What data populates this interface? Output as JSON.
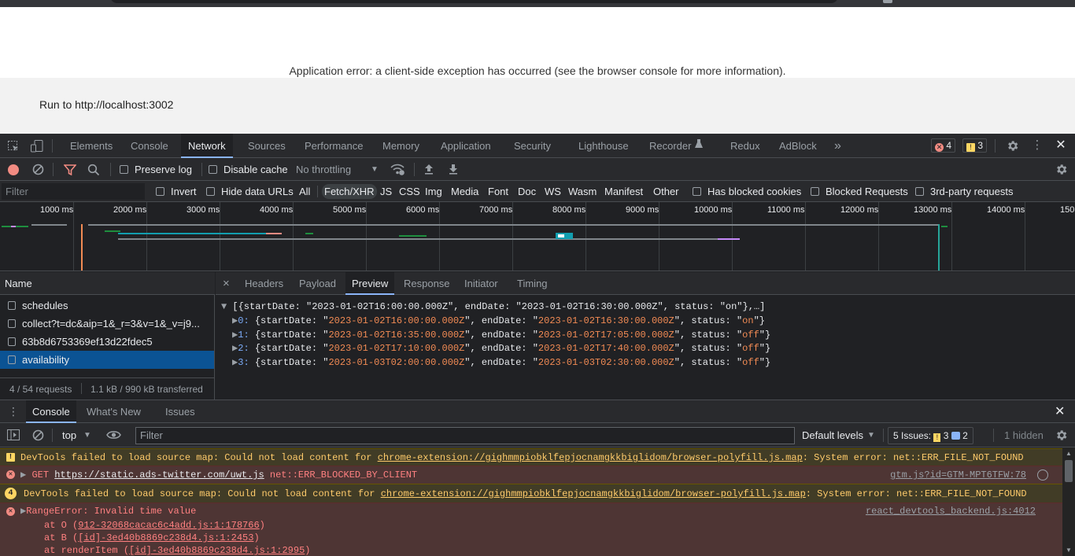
{
  "page": {
    "error_text": "Application error: a client-side exception has occurred (see the browser console for more information).",
    "run_text": "Run to http://localhost:3002"
  },
  "devtools": {
    "tabs": [
      "Elements",
      "Console",
      "Network",
      "Sources",
      "Performance",
      "Memory",
      "Application",
      "Security",
      "Lighthouse",
      "Recorder",
      "Redux",
      "AdBlock"
    ],
    "active_tab": "Network",
    "more_tabs": "»",
    "error_count": "4",
    "warning_count": "3"
  },
  "network_toolbar": {
    "preserve_log": "Preserve log",
    "disable_cache": "Disable cache",
    "throttling": "No throttling"
  },
  "filter_bar": {
    "placeholder": "Filter",
    "invert": "Invert",
    "hide_data_urls": "Hide data URLs",
    "types": [
      "All",
      "Fetch/XHR",
      "JS",
      "CSS",
      "Img",
      "Media",
      "Font",
      "Doc",
      "WS",
      "Wasm",
      "Manifest",
      "Other"
    ],
    "selected_type": "Fetch/XHR",
    "has_blocked_cookies": "Has blocked cookies",
    "blocked_requests": "Blocked Requests",
    "third_party": "3rd-party requests"
  },
  "timeline": {
    "ticks": [
      "1000 ms",
      "2000 ms",
      "3000 ms",
      "4000 ms",
      "5000 ms",
      "6000 ms",
      "7000 ms",
      "8000 ms",
      "9000 ms",
      "10000 ms",
      "11000 ms",
      "12000 ms",
      "13000 ms",
      "14000 ms",
      "150"
    ]
  },
  "requests": {
    "column": "Name",
    "items": [
      "schedules",
      "collect?t=dc&aip=1&_r=3&v=1&_v=j9...",
      "63b8d6753369ef13d22fdec5",
      "availability"
    ],
    "selected": "availability",
    "summary_count": "4 / 54 requests",
    "summary_size": "1.1 kB / 990 kB transferred"
  },
  "detail": {
    "close": "×",
    "tabs": [
      "Headers",
      "Payload",
      "Preview",
      "Response",
      "Initiator",
      "Timing"
    ],
    "active_tab": "Preview",
    "root": "[{startDate: \"2023-01-02T16:00:00.000Z\", endDate: \"2023-01-02T16:30:00.000Z\", status: \"on\"},…]",
    "items": [
      {
        "index": "0",
        "startDate": "2023-01-02T16:00:00.000Z",
        "endDate": "2023-01-02T16:30:00.000Z",
        "status": "on"
      },
      {
        "index": "1",
        "startDate": "2023-01-02T16:35:00.000Z",
        "endDate": "2023-01-02T17:05:00.000Z",
        "status": "off"
      },
      {
        "index": "2",
        "startDate": "2023-01-02T17:10:00.000Z",
        "endDate": "2023-01-02T17:40:00.000Z",
        "status": "off"
      },
      {
        "index": "3",
        "startDate": "2023-01-03T02:00:00.000Z",
        "endDate": "2023-01-03T02:30:00.000Z",
        "status": "off"
      }
    ]
  },
  "console": {
    "tabs": [
      "Console",
      "What's New",
      "Issues"
    ],
    "active_tab": "Console",
    "context": "top",
    "filter_placeholder": "Filter",
    "levels": "Default levels",
    "issues_label": "5 Issues:",
    "issues_warn": "3",
    "issues_info": "2",
    "hidden": "1 hidden",
    "messages": {
      "m1": {
        "prefix": "DevTools failed to load source map: Could not load content for ",
        "link": "chrome-extension://gighmmpiobklfepjocnamgkkbiglidom/browser-polyfill.js.map",
        "suffix": ": System error: net::ERR_FILE_NOT_FOUND"
      },
      "m2": {
        "method": "GET ",
        "link": "https://static.ads-twitter.com/uwt.js",
        "suffix": " net::ERR_BLOCKED_BY_CLIENT",
        "source": "gtm.js?id=GTM-MPT6TFW:78"
      },
      "m3": {
        "count": "4",
        "prefix": "DevTools failed to load source map: Could not load content for ",
        "link": "chrome-extension://gighmmpiobklfepjocnamgkkbiglidom/browser-polyfill.js.map",
        "suffix": ": System error: net::ERR_FILE_NOT_FOUND"
      },
      "m4": {
        "text": "RangeError: Invalid time value",
        "source": "react_devtools_backend.js:4012",
        "stack": [
          {
            "pre": "at O (",
            "link": "912-32068cacac6c4add.js:1:178766",
            "post": ")"
          },
          {
            "pre": "at B (",
            "link": "[id]-3ed40b8869c238d4.js:1:2453",
            "post": ")"
          },
          {
            "pre": "at renderItem (",
            "link": "[id]-3ed40b8869c238d4.js:1:2995",
            "post": ")"
          }
        ]
      }
    }
  },
  "colors": {
    "accent": "#8ab4f8",
    "selected_row": "#0b5394",
    "error_bg": "#4e3534",
    "warning_bg": "#413c26",
    "record": "#f28b82"
  }
}
